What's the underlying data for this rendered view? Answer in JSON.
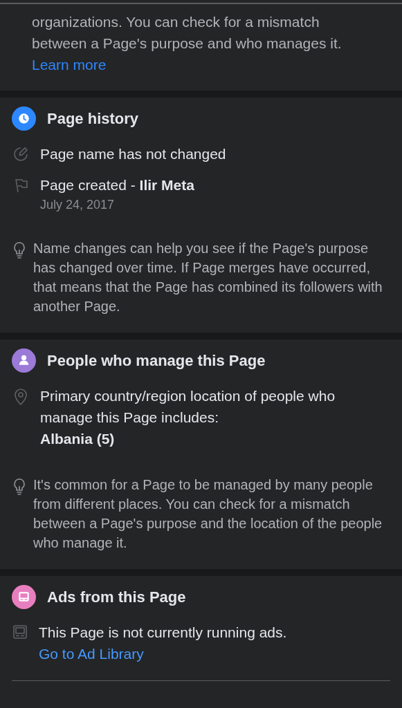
{
  "intro": {
    "text": "organizations. You can check for a mismatch between a Page's purpose and who manages it.",
    "link": "Learn more"
  },
  "sections": [
    {
      "title": "Page history",
      "kind": "clock",
      "color": "#2d88ff",
      "items": [
        {
          "kind": "edit",
          "text": "Page name has not changed"
        },
        {
          "kind": "flag",
          "text": "Page created - **Ilir Meta**",
          "sub": {
            "text": "July 24, 2017",
            "kind": "date"
          }
        }
      ],
      "tip": "Name changes can help you see if the Page's purpose has changed over time. If Page merges have occurred, that means that the Page has combined its followers with another Page."
    },
    {
      "title": "People who manage this Page",
      "kind": "person",
      "color": "#9b7ad8",
      "items": [
        {
          "kind": "pin",
          "text": "Primary country/region location of people who manage this Page includes:",
          "sub": {
            "text": "Albania (5)",
            "kind": "value"
          }
        }
      ],
      "tip": "It's common for a Page to be managed by many people from different places. You can check for a mismatch between a Page's purpose and the location of the people who manage it."
    },
    {
      "title": "Ads from this Page",
      "kind": "ad",
      "color": "#e77fbf",
      "items": [
        {
          "kind": "ad",
          "text": "This Page is not currently running ads.",
          "link": "Go to Ad Library"
        }
      ]
    }
  ]
}
